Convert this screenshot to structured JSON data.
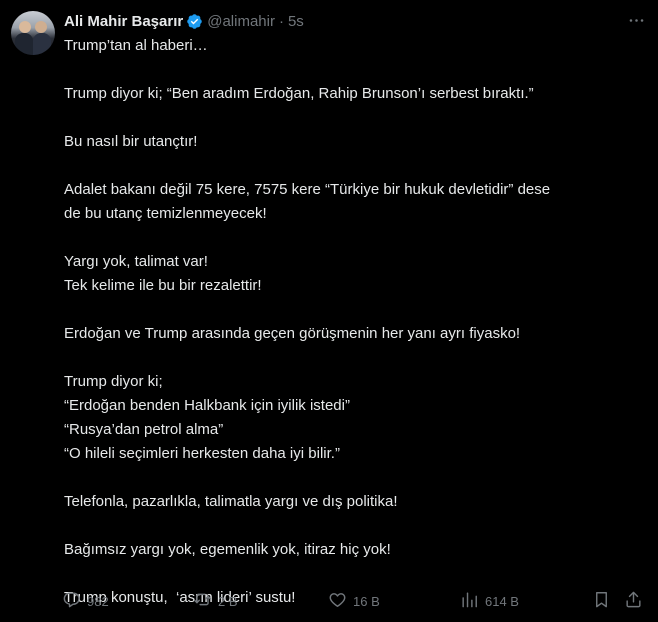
{
  "author": {
    "name": "Ali Mahir Başarır",
    "handle": "@alimahir",
    "time": "5s"
  },
  "tweet_text": [
    "Trump’tan al haberi…",
    "",
    "Trump diyor ki; “Ben aradım Erdoğan, Rahip Brunson’ı serbest bıraktı.”",
    "",
    "Bu nasıl bir utançtır!",
    "",
    "Adalet bakanı değil 75 kere, 7575 kere “Türkiye bir hukuk devletidir” dese",
    "de bu utanç temizlenmeyecek!",
    "",
    "Yargı yok, talimat var!",
    "Tek kelime ile bu bir rezalettir!",
    "",
    "Erdoğan ve Trump arasında geçen görüşmenin her yanı ayrı fiyasko!",
    "",
    "Trump diyor ki;",
    "“Erdoğan benden Halkbank için iyilik istedi”",
    "“Rusya’dan petrol alma”",
    "“O hileli seçimleri herkesten daha iyi bilir.”",
    "",
    "Telefonla, pazarlıkla, talimatla yargı ve dış politika!",
    "",
    "Bağımsız yargı yok, egemenlik yok, itiraz hiç yok!",
    "",
    "Trump konuştu,  ‘asrın lideri’ sustu!"
  ],
  "actions": {
    "replies": "982",
    "reposts": "2 B",
    "likes": "16 B",
    "views": "614 B"
  },
  "icons": {
    "verified": "verified-badge-icon",
    "more": "more-icon",
    "reply": "reply-icon",
    "repost": "repost-icon",
    "like": "heart-icon",
    "views": "views-icon",
    "bookmark": "bookmark-icon",
    "share": "share-icon"
  },
  "colors": {
    "background": "#000000",
    "text": "#e7e9ea",
    "muted": "#71767b",
    "verified": "#1d9bf0"
  }
}
